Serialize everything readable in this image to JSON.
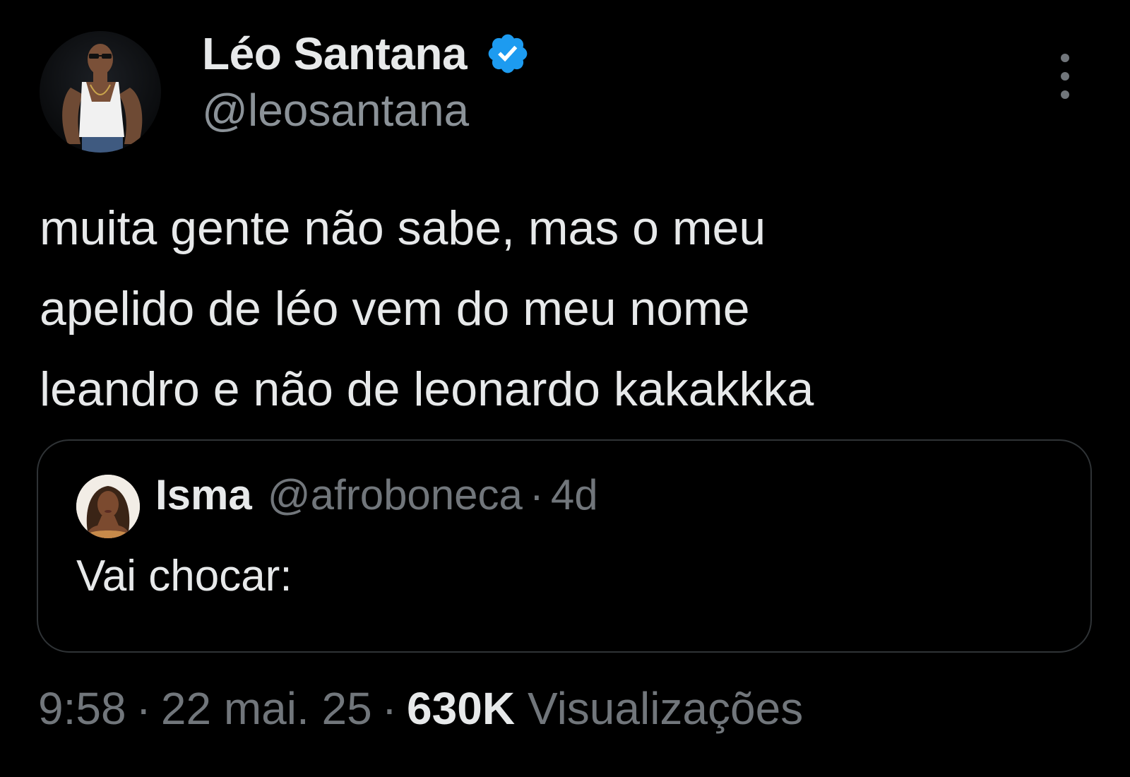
{
  "author": {
    "display_name": "Léo Santana",
    "handle": "@leosantana",
    "verified": true
  },
  "tweet": {
    "text_lines": [
      "muita gente não sabe, mas o meu",
      "apelido de léo vem do meu nome",
      "leandro e não de leonardo kakakkka"
    ]
  },
  "quoted_tweet": {
    "display_name": "Isma",
    "handle": "@afroboneca",
    "separator": "·",
    "time": "4d",
    "text": "Vai chocar:"
  },
  "meta": {
    "time": "9:58",
    "separator": "·",
    "date": "22 mai. 25",
    "views_count": "630K",
    "views_label": "Visualizações"
  },
  "colors": {
    "background": "#000000",
    "primary_text": "#e7e9ea",
    "secondary_text": "#71767b",
    "verified_blue": "#1d9bf0",
    "border": "#2f3336"
  },
  "icons": {
    "verified": "verified-badge-icon",
    "more": "more-vertical-icon"
  }
}
